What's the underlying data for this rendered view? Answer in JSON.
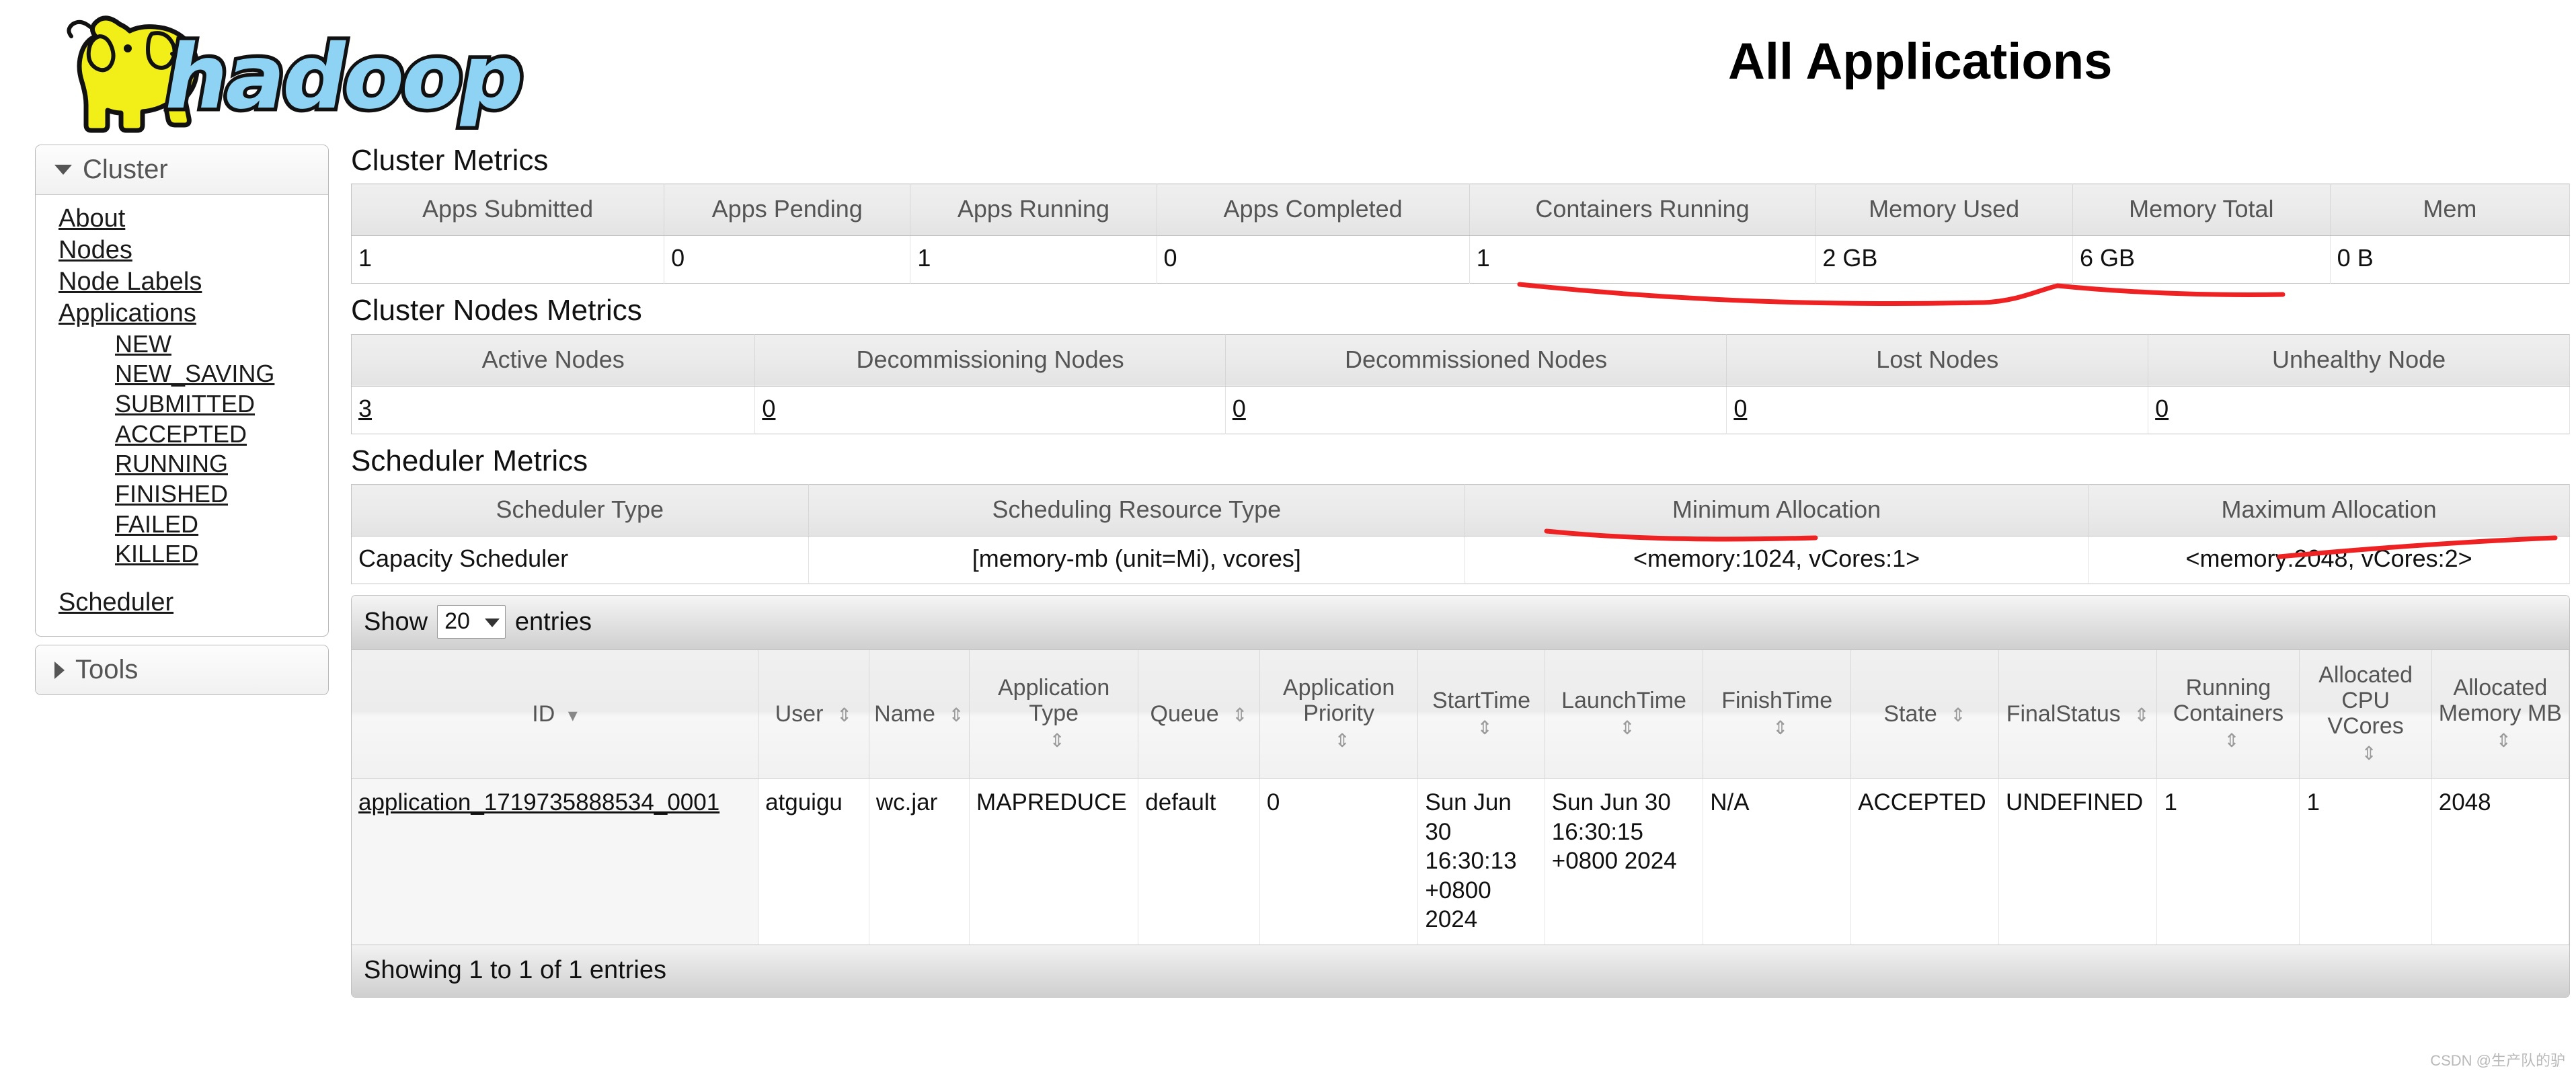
{
  "header": {
    "logo_text": "hadoop",
    "title": "All Applications"
  },
  "sidebar": {
    "cluster": {
      "label": "Cluster",
      "items": [
        {
          "label": "About"
        },
        {
          "label": "Nodes"
        },
        {
          "label": "Node Labels"
        },
        {
          "label": "Applications"
        }
      ],
      "app_states": [
        {
          "label": "NEW"
        },
        {
          "label": "NEW_SAVING"
        },
        {
          "label": "SUBMITTED"
        },
        {
          "label": "ACCEPTED"
        },
        {
          "label": "RUNNING"
        },
        {
          "label": "FINISHED"
        },
        {
          "label": "FAILED"
        },
        {
          "label": "KILLED"
        }
      ],
      "scheduler": {
        "label": "Scheduler"
      }
    },
    "tools": {
      "label": "Tools"
    }
  },
  "cluster_metrics": {
    "heading": "Cluster Metrics",
    "headers": [
      "Apps Submitted",
      "Apps Pending",
      "Apps Running",
      "Apps Completed",
      "Containers Running",
      "Memory Used",
      "Memory Total",
      "Mem"
    ],
    "values": [
      "1",
      "0",
      "1",
      "0",
      "1",
      "2 GB",
      "6 GB",
      "0 B"
    ]
  },
  "cluster_nodes_metrics": {
    "heading": "Cluster Nodes Metrics",
    "headers": [
      "Active Nodes",
      "Decommissioning Nodes",
      "Decommissioned Nodes",
      "Lost Nodes",
      "Unhealthy Node"
    ],
    "values": [
      "3",
      "0",
      "0",
      "0",
      "0"
    ]
  },
  "scheduler_metrics": {
    "heading": "Scheduler Metrics",
    "headers": [
      "Scheduler Type",
      "Scheduling Resource Type",
      "Minimum Allocation",
      "Maximum Allocation"
    ],
    "values": [
      "Capacity Scheduler",
      "[memory-mb (unit=Mi), vcores]",
      "<memory:1024, vCores:1>",
      "<memory:2048, vCores:2>"
    ]
  },
  "datatable": {
    "show_label": "Show",
    "page_length": "20",
    "entries_label": "entries",
    "columns": [
      {
        "label": "ID",
        "sort": "desc"
      },
      {
        "label": "User",
        "sort": "both"
      },
      {
        "label": "Name",
        "sort": "both"
      },
      {
        "label": "Application Type",
        "sort": "both"
      },
      {
        "label": "Queue",
        "sort": "both"
      },
      {
        "label": "Application Priority",
        "sort": "both"
      },
      {
        "label": "StartTime",
        "sort": "both"
      },
      {
        "label": "LaunchTime",
        "sort": "both"
      },
      {
        "label": "FinishTime",
        "sort": "both"
      },
      {
        "label": "State",
        "sort": "both"
      },
      {
        "label": "FinalStatus",
        "sort": "both"
      },
      {
        "label": "Running Containers",
        "sort": "both"
      },
      {
        "label": "Allocated CPU VCores",
        "sort": "both"
      },
      {
        "label": "Allocated Memory MB",
        "sort": "both"
      }
    ],
    "rows": [
      {
        "id": "application_1719735888534_0001",
        "user": "atguigu",
        "name": "wc.jar",
        "application_type": "MAPREDUCE",
        "queue": "default",
        "application_priority": "0",
        "start_time": "Sun Jun 30 16:30:13 +0800 2024",
        "launch_time": "Sun Jun 30 16:30:15 +0800 2024",
        "finish_time": "N/A",
        "state": "ACCEPTED",
        "final_status": "UNDEFINED",
        "running_containers": "1",
        "allocated_cpu_vcores": "1",
        "allocated_memory_mb": "2048"
      }
    ],
    "info": "Showing 1 to 1 of 1 entries"
  },
  "annotations": {
    "color": "#ee2222",
    "watermark": "CSDN @生产队的驴"
  }
}
